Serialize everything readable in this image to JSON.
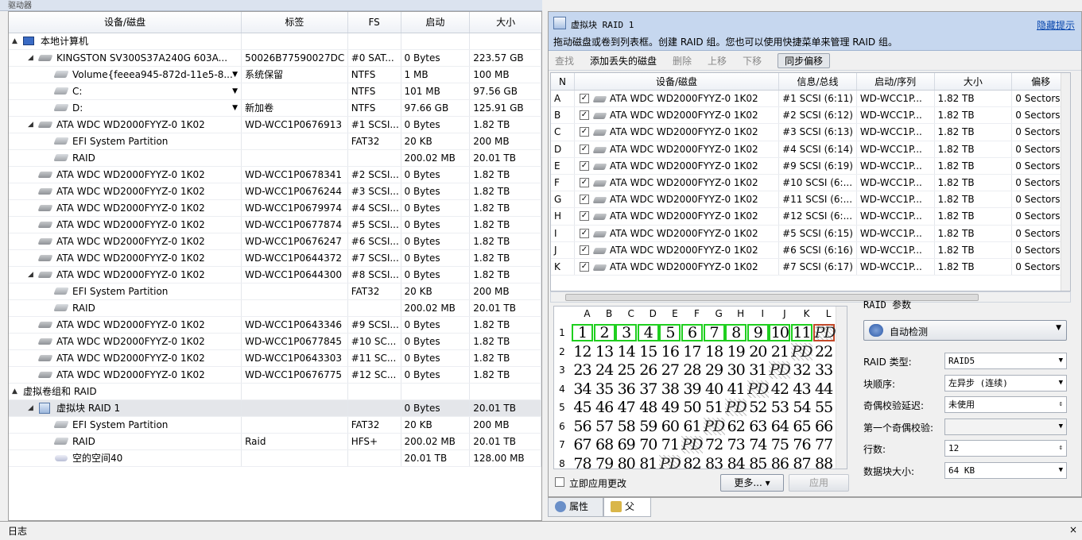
{
  "left_panel": {
    "title": "驱动器",
    "columns": [
      "设备/磁盘",
      "标签",
      "FS",
      "启动",
      "大小"
    ],
    "rows": [
      {
        "indent": 0,
        "tri": "▲",
        "icon": "pc",
        "name": "本地计算机",
        "label": "",
        "fs": "",
        "start": "",
        "size": ""
      },
      {
        "indent": 1,
        "tri": "◢",
        "icon": "disk",
        "name": "KINGSTON SV300S37A240G 603A...",
        "label": "50026B77590027DC",
        "fs": "#0 SAT...",
        "start": "0 Bytes",
        "size": "223.57 GB"
      },
      {
        "indent": 2,
        "tri": "",
        "icon": "vol",
        "name": "Volume{feeea945-872d-11e5-8...",
        "label": "系统保留",
        "fs": "NTFS",
        "start": "1 MB",
        "size": "100 MB",
        "dd": true
      },
      {
        "indent": 2,
        "tri": "",
        "icon": "vol",
        "name": "C:",
        "label": "",
        "fs": "NTFS",
        "start": "101 MB",
        "size": "97.56 GB",
        "dd": true
      },
      {
        "indent": 2,
        "tri": "",
        "icon": "vol",
        "name": "D:",
        "label": "新加卷",
        "fs": "NTFS",
        "start": "97.66 GB",
        "size": "125.91 GB",
        "dd": true
      },
      {
        "indent": 1,
        "tri": "◢",
        "icon": "disk",
        "name": "ATA WDC WD2000FYYZ-0 1K02",
        "label": "WD-WCC1P0676913",
        "fs": "#1 SCSI...",
        "start": "0 Bytes",
        "size": "1.82 TB"
      },
      {
        "indent": 2,
        "tri": "",
        "icon": "vol",
        "name": "EFI System Partition",
        "label": "",
        "fs": "FAT32",
        "start": "20 KB",
        "size": "200 MB"
      },
      {
        "indent": 2,
        "tri": "",
        "icon": "vol",
        "name": "RAID",
        "label": "",
        "fs": "",
        "start": "200.02 MB",
        "size": "20.01 TB"
      },
      {
        "indent": 1,
        "tri": "",
        "icon": "disk",
        "name": "ATA WDC WD2000FYYZ-0 1K02",
        "label": "WD-WCC1P0678341",
        "fs": "#2 SCSI...",
        "start": "0 Bytes",
        "size": "1.82 TB"
      },
      {
        "indent": 1,
        "tri": "",
        "icon": "disk",
        "name": "ATA WDC WD2000FYYZ-0 1K02",
        "label": "WD-WCC1P0676244",
        "fs": "#3 SCSI...",
        "start": "0 Bytes",
        "size": "1.82 TB"
      },
      {
        "indent": 1,
        "tri": "",
        "icon": "disk",
        "name": "ATA WDC WD2000FYYZ-0 1K02",
        "label": "WD-WCC1P0679974",
        "fs": "#4 SCSI...",
        "start": "0 Bytes",
        "size": "1.82 TB"
      },
      {
        "indent": 1,
        "tri": "",
        "icon": "disk",
        "name": "ATA WDC WD2000FYYZ-0 1K02",
        "label": "WD-WCC1P0677874",
        "fs": "#5 SCSI...",
        "start": "0 Bytes",
        "size": "1.82 TB"
      },
      {
        "indent": 1,
        "tri": "",
        "icon": "disk",
        "name": "ATA WDC WD2000FYYZ-0 1K02",
        "label": "WD-WCC1P0676247",
        "fs": "#6 SCSI...",
        "start": "0 Bytes",
        "size": "1.82 TB"
      },
      {
        "indent": 1,
        "tri": "",
        "icon": "disk",
        "name": "ATA WDC WD2000FYYZ-0 1K02",
        "label": "WD-WCC1P0644372",
        "fs": "#7 SCSI...",
        "start": "0 Bytes",
        "size": "1.82 TB"
      },
      {
        "indent": 1,
        "tri": "◢",
        "icon": "disk",
        "name": "ATA WDC WD2000FYYZ-0 1K02",
        "label": "WD-WCC1P0644300",
        "fs": "#8 SCSI...",
        "start": "0 Bytes",
        "size": "1.82 TB"
      },
      {
        "indent": 2,
        "tri": "",
        "icon": "vol",
        "name": "EFI System Partition",
        "label": "",
        "fs": "FAT32",
        "start": "20 KB",
        "size": "200 MB"
      },
      {
        "indent": 2,
        "tri": "",
        "icon": "vol",
        "name": "RAID",
        "label": "",
        "fs": "",
        "start": "200.02 MB",
        "size": "20.01 TB"
      },
      {
        "indent": 1,
        "tri": "",
        "icon": "disk",
        "name": "ATA WDC WD2000FYYZ-0 1K02",
        "label": "WD-WCC1P0643346",
        "fs": "#9 SCSI...",
        "start": "0 Bytes",
        "size": "1.82 TB"
      },
      {
        "indent": 1,
        "tri": "",
        "icon": "disk",
        "name": "ATA WDC WD2000FYYZ-0 1K02",
        "label": "WD-WCC1P0677845",
        "fs": "#10 SC...",
        "start": "0 Bytes",
        "size": "1.82 TB"
      },
      {
        "indent": 1,
        "tri": "",
        "icon": "disk",
        "name": "ATA WDC WD2000FYYZ-0 1K02",
        "label": "WD-WCC1P0643303",
        "fs": "#11 SC...",
        "start": "0 Bytes",
        "size": "1.82 TB"
      },
      {
        "indent": 1,
        "tri": "",
        "icon": "disk",
        "name": "ATA WDC WD2000FYYZ-0 1K02",
        "label": "WD-WCC1P0676775",
        "fs": "#12 SC...",
        "start": "0 Bytes",
        "size": "1.82 TB"
      },
      {
        "indent": 0,
        "tri": "▲",
        "icon": "grp",
        "name": "虚拟卷组和 RAID",
        "label": "",
        "fs": "",
        "start": "",
        "size": ""
      },
      {
        "indent": 1,
        "tri": "◢",
        "icon": "raid",
        "name": "虚拟块 RAID 1",
        "label": "",
        "fs": "",
        "start": "0 Bytes",
        "size": "20.01 TB",
        "selected": true
      },
      {
        "indent": 2,
        "tri": "",
        "icon": "vol",
        "name": "EFI System Partition",
        "label": "",
        "fs": "FAT32",
        "start": "20 KB",
        "size": "200 MB"
      },
      {
        "indent": 2,
        "tri": "",
        "icon": "vol",
        "name": "RAID",
        "label": "Raid",
        "fs": "HFS+",
        "start": "200.02 MB",
        "size": "20.01 TB"
      },
      {
        "indent": 2,
        "tri": "",
        "icon": "free",
        "name": "空的空间40",
        "label": "",
        "fs": "",
        "start": "20.01 TB",
        "size": "128.00 MB"
      }
    ]
  },
  "right_panel": {
    "header_title": "虚拟块 RAID 1",
    "header_desc": "拖动磁盘或卷到列表框。创建 RAID 组。您也可以使用快捷菜单来管理 RAID 组。",
    "hide_hint": "隐藏提示",
    "toolbar": [
      {
        "label": "查找",
        "enabled": false
      },
      {
        "label": "添加丢失的磁盘",
        "enabled": true
      },
      {
        "label": "删除",
        "enabled": false
      },
      {
        "label": "上移",
        "enabled": false
      },
      {
        "label": "下移",
        "enabled": false
      },
      {
        "label": "同步偏移",
        "enabled": true,
        "pressed": true
      }
    ],
    "columns": [
      "N",
      "设备/磁盘",
      "信息/总线",
      "启动/序列",
      "大小",
      "偏移"
    ],
    "rows": [
      {
        "n": "A",
        "disk": "ATA WDC WD2000FYYZ-0 1K02",
        "bus": "#1 SCSI (6:11)",
        "serial": "WD-WCC1P...",
        "size": "1.82 TB",
        "offset": "0 Sectors"
      },
      {
        "n": "B",
        "disk": "ATA WDC WD2000FYYZ-0 1K02",
        "bus": "#2 SCSI (6:12)",
        "serial": "WD-WCC1P...",
        "size": "1.82 TB",
        "offset": "0 Sectors"
      },
      {
        "n": "C",
        "disk": "ATA WDC WD2000FYYZ-0 1K02",
        "bus": "#3 SCSI (6:13)",
        "serial": "WD-WCC1P...",
        "size": "1.82 TB",
        "offset": "0 Sectors"
      },
      {
        "n": "D",
        "disk": "ATA WDC WD2000FYYZ-0 1K02",
        "bus": "#4 SCSI (6:14)",
        "serial": "WD-WCC1P...",
        "size": "1.82 TB",
        "offset": "0 Sectors"
      },
      {
        "n": "E",
        "disk": "ATA WDC WD2000FYYZ-0 1K02",
        "bus": "#9 SCSI (6:19)",
        "serial": "WD-WCC1P...",
        "size": "1.82 TB",
        "offset": "0 Sectors"
      },
      {
        "n": "F",
        "disk": "ATA WDC WD2000FYYZ-0 1K02",
        "bus": "#10 SCSI (6:...",
        "serial": "WD-WCC1P...",
        "size": "1.82 TB",
        "offset": "0 Sectors"
      },
      {
        "n": "G",
        "disk": "ATA WDC WD2000FYYZ-0 1K02",
        "bus": "#11 SCSI (6:...",
        "serial": "WD-WCC1P...",
        "size": "1.82 TB",
        "offset": "0 Sectors"
      },
      {
        "n": "H",
        "disk": "ATA WDC WD2000FYYZ-0 1K02",
        "bus": "#12 SCSI (6:...",
        "serial": "WD-WCC1P...",
        "size": "1.82 TB",
        "offset": "0 Sectors"
      },
      {
        "n": "I",
        "disk": "ATA WDC WD2000FYYZ-0 1K02",
        "bus": "#5 SCSI (6:15)",
        "serial": "WD-WCC1P...",
        "size": "1.82 TB",
        "offset": "0 Sectors"
      },
      {
        "n": "J",
        "disk": "ATA WDC WD2000FYYZ-0 1K02",
        "bus": "#6 SCSI (6:16)",
        "serial": "WD-WCC1P...",
        "size": "1.82 TB",
        "offset": "0 Sectors"
      },
      {
        "n": "K",
        "disk": "ATA WDC WD2000FYYZ-0 1K02",
        "bus": "#7 SCSI (6:17)",
        "serial": "WD-WCC1P...",
        "size": "1.82 TB",
        "offset": "0 Sectors"
      }
    ],
    "matrix": {
      "cols": [
        "A",
        "B",
        "C",
        "D",
        "E",
        "F",
        "G",
        "H",
        "I",
        "J",
        "K",
        "L"
      ],
      "rows": [
        [
          "1",
          "2",
          "3",
          "4",
          "5",
          "6",
          "7",
          "8",
          "9",
          "10",
          "11",
          "PD"
        ],
        [
          "12",
          "13",
          "14",
          "15",
          "16",
          "17",
          "18",
          "19",
          "20",
          "21",
          "PD",
          "22"
        ],
        [
          "23",
          "24",
          "25",
          "26",
          "27",
          "28",
          "29",
          "30",
          "31",
          "PD",
          "32",
          "33"
        ],
        [
          "34",
          "35",
          "36",
          "37",
          "38",
          "39",
          "40",
          "41",
          "PD",
          "42",
          "43",
          "44"
        ],
        [
          "45",
          "46",
          "47",
          "48",
          "49",
          "50",
          "51",
          "PD",
          "52",
          "53",
          "54",
          "55"
        ],
        [
          "56",
          "57",
          "58",
          "59",
          "60",
          "61",
          "PD",
          "62",
          "63",
          "64",
          "65",
          "66"
        ],
        [
          "67",
          "68",
          "69",
          "70",
          "71",
          "PD",
          "72",
          "73",
          "74",
          "75",
          "76",
          "77"
        ],
        [
          "78",
          "79",
          "80",
          "81",
          "PD",
          "82",
          "83",
          "84",
          "85",
          "86",
          "87",
          "88"
        ]
      ]
    },
    "apply_now_label": "立即应用更改",
    "more_button": "更多...",
    "apply_button": "应用",
    "params": {
      "title": "RAID 参数",
      "auto_detect": "自动检测",
      "fields": [
        {
          "label": "RAID 类型:",
          "value": "RAID5",
          "dropdown": true
        },
        {
          "label": "块顺序:",
          "value": "左异步 (连续)",
          "dropdown": true
        },
        {
          "label": "奇偶校验延迟:",
          "value": "未使用",
          "spin": true
        },
        {
          "label": "第一个奇偶校验:",
          "value": "",
          "dropdown": true,
          "disabled": true
        },
        {
          "label": "行数:",
          "value": "12",
          "spin": true
        },
        {
          "label": "数据块大小:",
          "value": "64 KB",
          "dropdown": true
        }
      ]
    },
    "tabs": [
      "属性",
      "父"
    ]
  },
  "log_panel": {
    "title": "日志",
    "close": "×"
  },
  "colors": {
    "highlight": "#c6d7ef",
    "green_cell": "#1fcf1f",
    "parity_cell": "#c34a2a",
    "link": "#0645ad"
  }
}
